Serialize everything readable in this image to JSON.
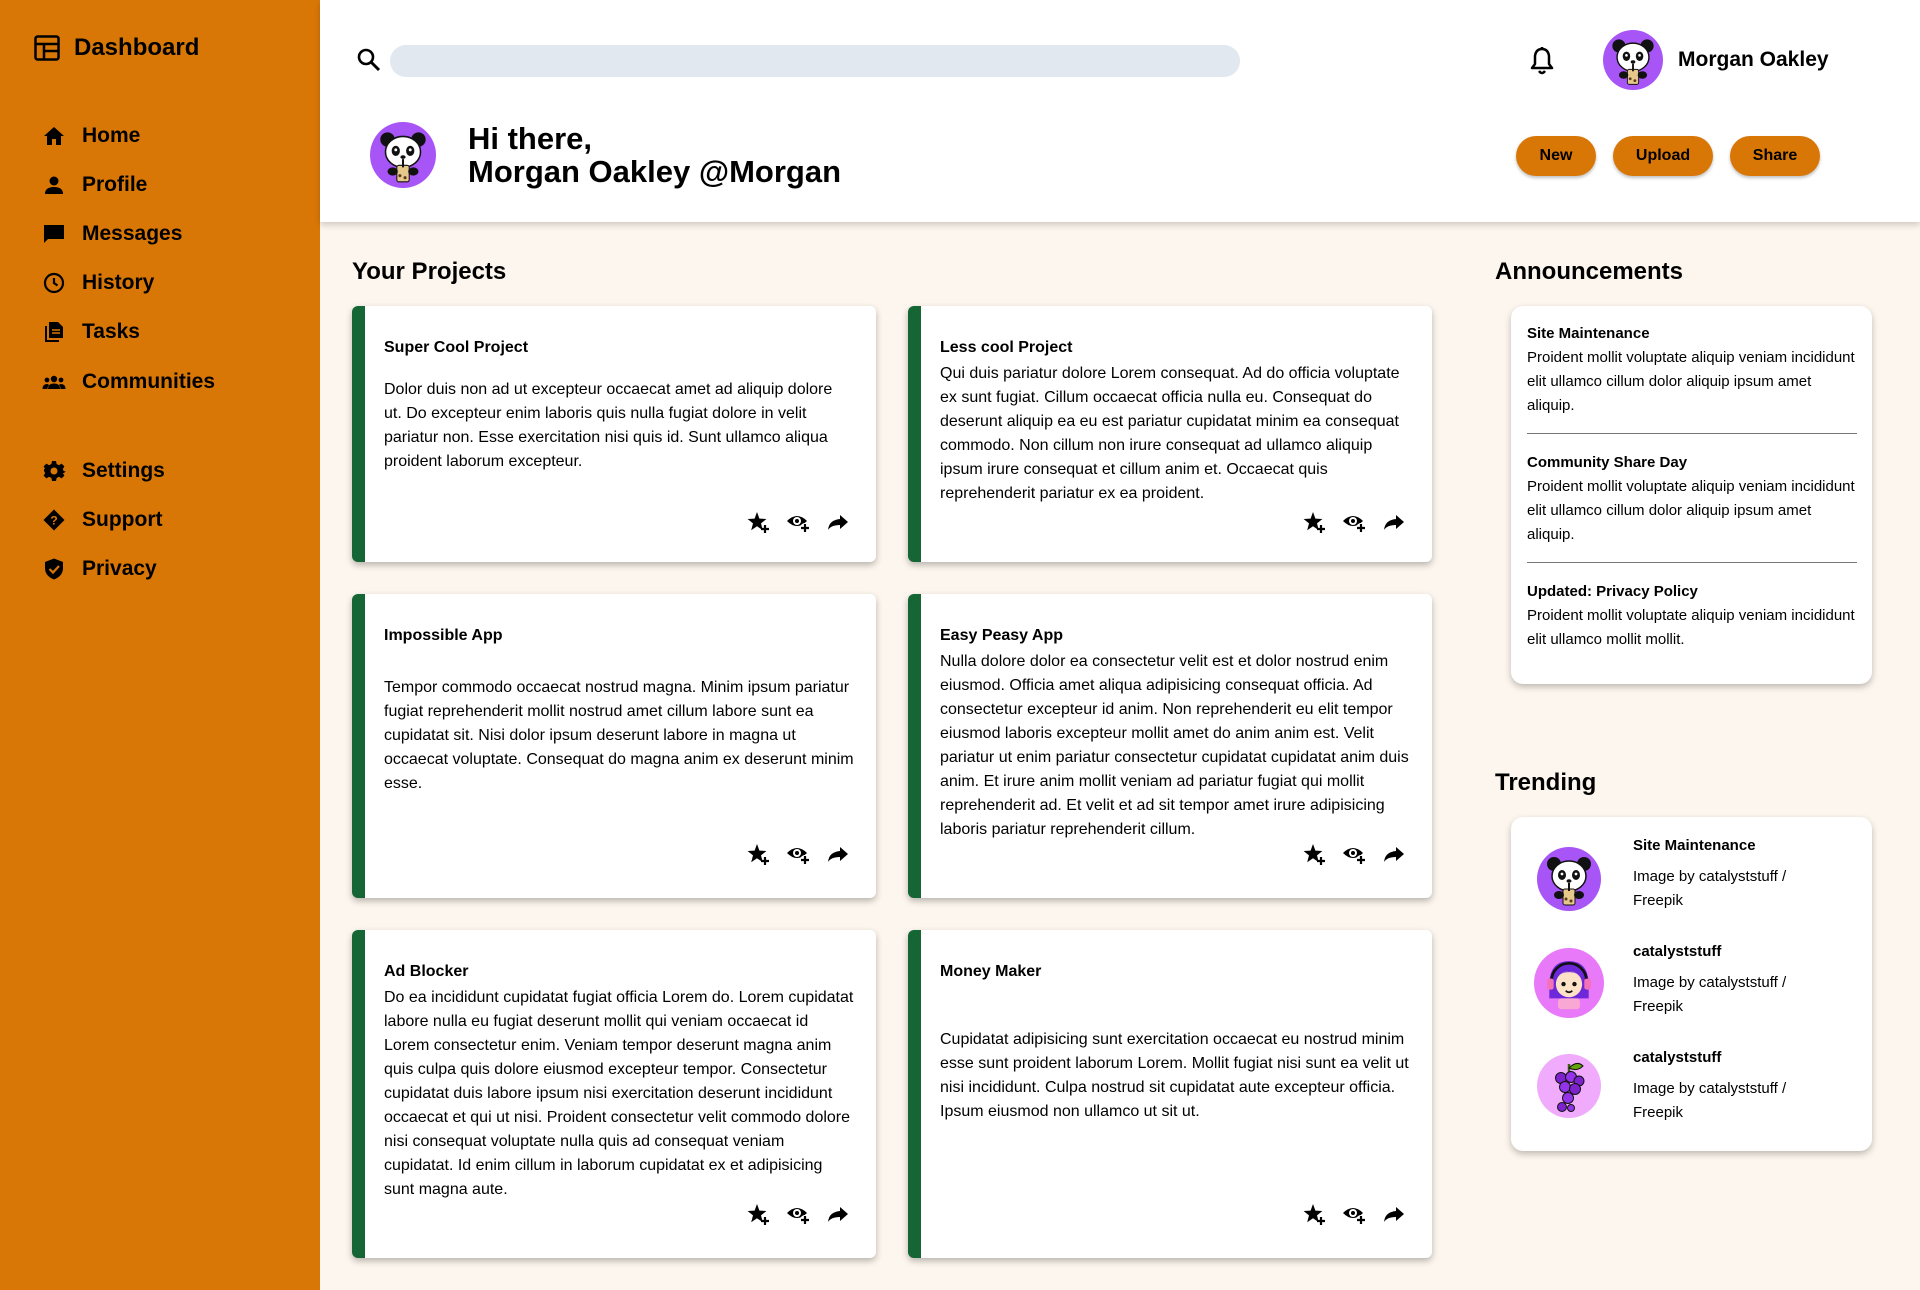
{
  "sidebar": {
    "title": "Dashboard",
    "nav": [
      {
        "label": "Home",
        "icon": "home-icon"
      },
      {
        "label": "Profile",
        "icon": "person-icon"
      },
      {
        "label": "Messages",
        "icon": "chat-icon"
      },
      {
        "label": "History",
        "icon": "clock-icon"
      },
      {
        "label": "Tasks",
        "icon": "document-icon"
      },
      {
        "label": "Communities",
        "icon": "group-icon"
      }
    ],
    "secondary": [
      {
        "label": "Settings",
        "icon": "gear-icon"
      },
      {
        "label": "Support",
        "icon": "help-diamond-icon"
      },
      {
        "label": "Privacy",
        "icon": "shield-icon"
      }
    ]
  },
  "header": {
    "search_value": "",
    "user_name": "Morgan Oakley",
    "greeting_line1": "Hi there,",
    "greeting_line2": "Morgan Oakley @Morgan",
    "buttons": {
      "new": "New",
      "upload": "Upload",
      "share": "Share"
    }
  },
  "projects": {
    "title": "Your Projects",
    "items": [
      {
        "title": "Super Cool Project",
        "body": "Dolor duis non ad ut excepteur occaecat amet ad aliquip dolore ut. Do excepteur enim laboris quis nulla fugiat dolore in velit pariatur non. Esse exercitation nisi quis id. Sunt ullamco aliqua proident laborum excepteur."
      },
      {
        "title": "Less cool Project",
        "body": "Qui duis pariatur dolore Lorem consequat. Ad do officia voluptate ex sunt fugiat. Cillum occaecat officia nulla eu. Consequat do deserunt aliquip ea eu est pariatur cupidatat minim ea consequat commodo. Non cillum non irure consequat ad ullamco aliquip ipsum irure consequat et cillum anim et. Occaecat quis reprehenderit pariatur ex ea proident."
      },
      {
        "title": "Impossible App",
        "body": "Tempor commodo occaecat nostrud magna. Minim ipsum pariatur fugiat reprehenderit mollit nostrud amet cillum labore sunt ea cupidatat sit. Nisi dolor ipsum deserunt labore in magna ut occaecat voluptate. Consequat do magna anim ex deserunt minim esse."
      },
      {
        "title": "Easy Peasy App",
        "body": "Nulla dolore dolor ea consectetur velit est et dolor nostrud enim eiusmod. Officia amet aliqua adipisicing consequat officia. Ad consectetur excepteur id anim. Non reprehenderit eu elit tempor eiusmod laboris excepteur mollit amet do anim anim est. Velit pariatur ut enim pariatur consectetur cupidatat cupidatat anim duis anim. Et irure anim mollit veniam ad pariatur fugiat qui mollit reprehenderit ad. Et velit et ad sit tempor amet irure adipisicing laboris pariatur reprehenderit cillum."
      },
      {
        "title": "Ad Blocker",
        "body": "Do ea incididunt cupidatat fugiat officia Lorem do. Lorem cupidatat labore nulla eu fugiat deserunt mollit qui veniam occaecat id Lorem consectetur enim. Veniam tempor deserunt magna anim quis culpa quis dolore eiusmod excepteur tempor. Consectetur cupidatat duis labore ipsum nisi exercitation deserunt incididunt occaecat et qui ut nisi. Proident consectetur velit commodo dolore nisi consequat voluptate nulla quis ad consequat veniam cupidatat. Id enim cillum in laborum cupidatat ex et adipisicing sunt magna aute."
      },
      {
        "title": "Money Maker",
        "body": "Cupidatat adipisicing sunt exercitation occaecat eu nostrud minim esse sunt proident laborum Lorem. Mollit fugiat nisi sunt ea velit ut nisi incididunt. Culpa nostrud sit cupidatat aute excepteur officia. Ipsum eiusmod non ullamco ut sit ut."
      }
    ]
  },
  "announcements": {
    "title": "Announcements",
    "items": [
      {
        "title": "Site Maintenance",
        "body": "Proident mollit voluptate aliquip veniam incididunt elit ullamco cillum dolor aliquip ipsum amet aliquip."
      },
      {
        "title": "Community Share Day",
        "body": "Proident mollit voluptate aliquip veniam incididunt elit ullamco cillum dolor aliquip ipsum amet aliquip."
      },
      {
        "title": "Updated: Privacy Policy",
        "body": "Proident mollit voluptate aliquip veniam incididunt elit ullamco mollit mollit."
      }
    ]
  },
  "trending": {
    "title": "Trending",
    "items": [
      {
        "title": "Site Maintenance",
        "body": "Image by catalyststuff / Freepik",
        "icon": "panda-avatar"
      },
      {
        "title": "catalyststuff",
        "body": "Image by catalyststuff / Freepik",
        "icon": "girl-gamer-avatar"
      },
      {
        "title": "catalyststuff",
        "body": "Image by catalyststuff / Freepik",
        "icon": "grapes-avatar"
      }
    ]
  },
  "colors": {
    "sidebar": "#d97706",
    "accent": "#d97706",
    "card_border": "#166534",
    "background": "#fdf6ee",
    "search": "#e2e8f0",
    "avatar": "#a855f7"
  }
}
